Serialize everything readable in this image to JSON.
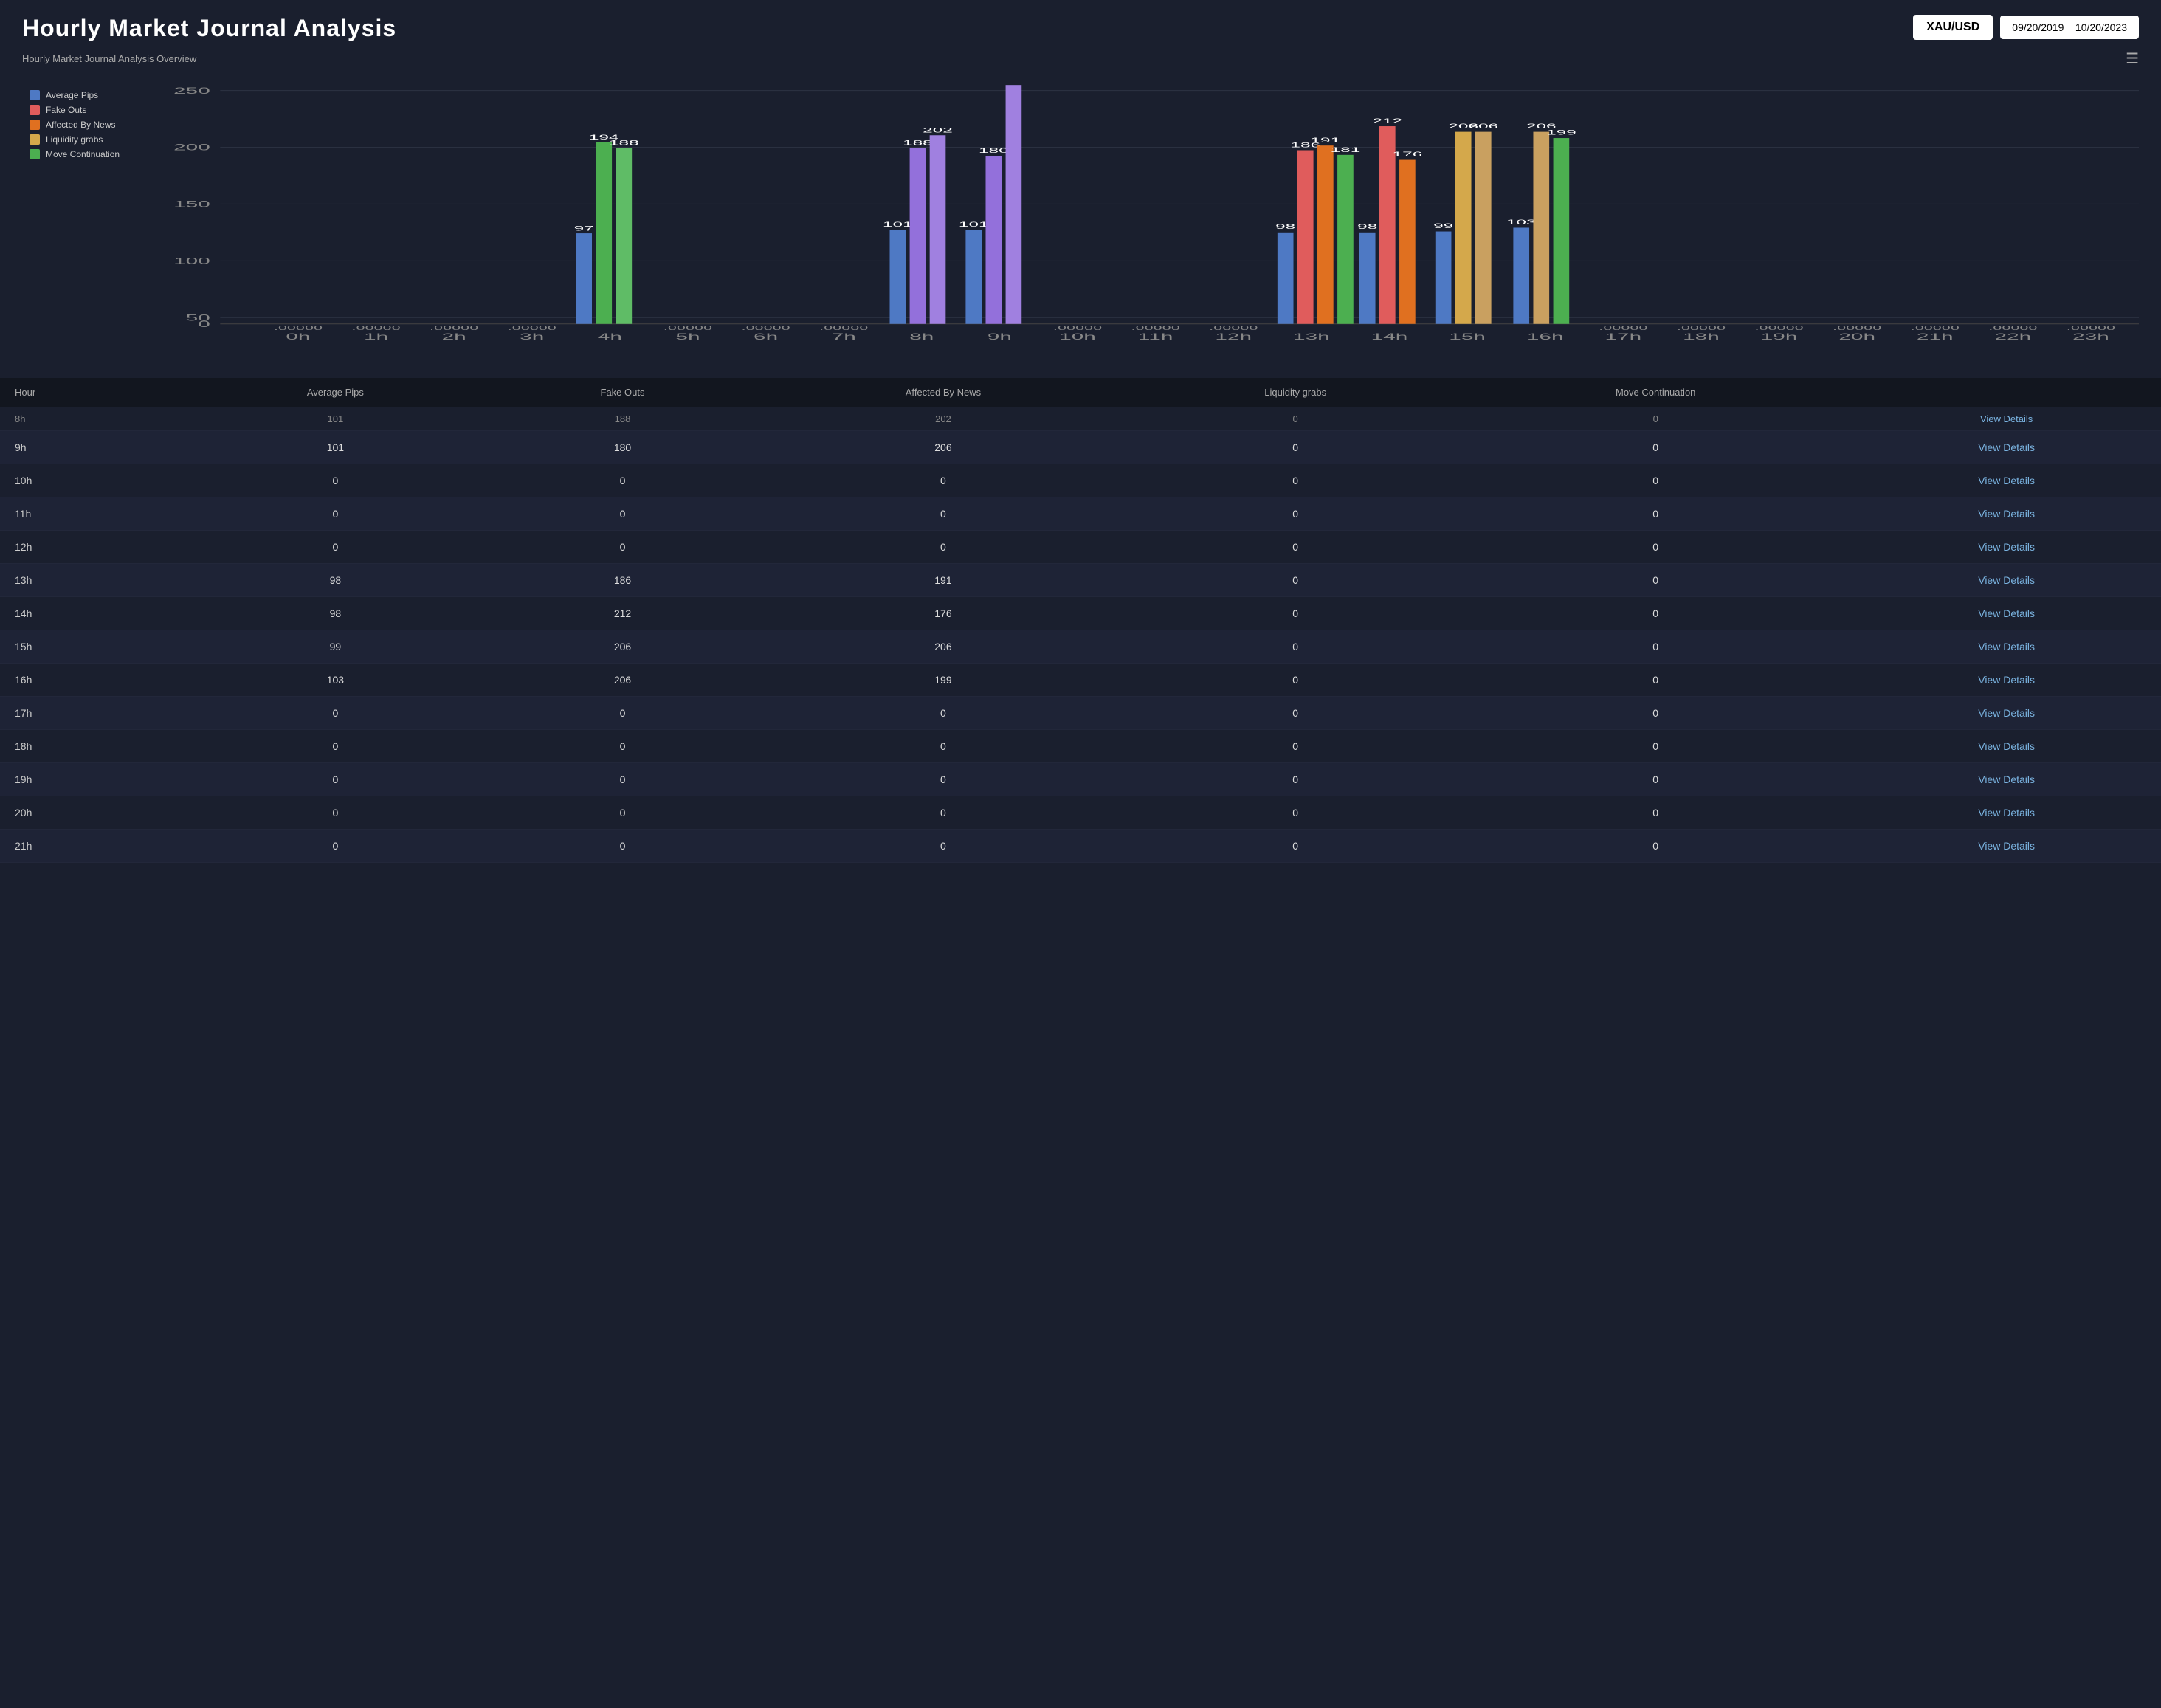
{
  "app": {
    "title": "Hourly Market Journal Analysis",
    "subtitle": "Hourly Market Journal Analysis Overview",
    "ticker": "XAU/USD",
    "date_start": "09/20/2019",
    "date_end": "10/20/2023"
  },
  "legend": [
    {
      "label": "Average Pips",
      "color": "#4e79c4"
    },
    {
      "label": "Fake Outs",
      "color": "#e05c5c"
    },
    {
      "label": "Affected By News",
      "color": "#e07020"
    },
    {
      "label": "Liquidity grabs",
      "color": "#d4a84b"
    },
    {
      "label": "Move Continuation",
      "color": "#4caf50"
    }
  ],
  "chart": {
    "y_max": 250,
    "y_labels": [
      0,
      50,
      100,
      150,
      200,
      250
    ],
    "x_labels": [
      "0h",
      "1h",
      "2h",
      "3h",
      "4h",
      "5h",
      "6h",
      "7h",
      "8h",
      "9h",
      "10h",
      "11h",
      "12h",
      "13h",
      "14h",
      "15h",
      "16h",
      "17h",
      "18h",
      "19h",
      "20h",
      "21h",
      "22h",
      "23h"
    ],
    "bars": {
      "4h": {
        "avg": 97,
        "fake": 0,
        "news": 0,
        "liq": 0,
        "cont": 194
      },
      "8h": {
        "avg": 101,
        "fake": 188,
        "news": 202,
        "liq": 0,
        "cont": 0
      },
      "9h": {
        "avg": 101,
        "fake": 180,
        "news": 256,
        "liq": 0,
        "cont": 0
      },
      "13h": {
        "avg": 98,
        "fake": 186,
        "news": 191,
        "liq": 0,
        "cont": 181
      },
      "14h": {
        "avg": 98,
        "fake": 212,
        "news": 176,
        "liq": 0,
        "cont": 0
      },
      "15h": {
        "avg": 99,
        "fake": 206,
        "news": 206,
        "liq": 0,
        "cont": 0
      },
      "16h": {
        "avg": 103,
        "fake": 0,
        "news": 199,
        "liq": 0,
        "cont": 206
      }
    }
  },
  "table": {
    "columns": [
      "Hour",
      "Average Pips",
      "Fake Outs",
      "Affected By News",
      "Liquidity grabs",
      "Move Continuation",
      ""
    ],
    "partial_row": {
      "hour": "8h",
      "avg": 101,
      "fake": 188,
      "news": 202,
      "liq": 0,
      "cont": 0
    },
    "rows": [
      {
        "hour": "9h",
        "avg": 101,
        "fake": 180,
        "news": 206,
        "liq": 0,
        "cont": 0,
        "action": "View Details"
      },
      {
        "hour": "10h",
        "avg": 0,
        "fake": 0,
        "news": 0,
        "liq": 0,
        "cont": 0,
        "action": "View Details"
      },
      {
        "hour": "11h",
        "avg": 0,
        "fake": 0,
        "news": 0,
        "liq": 0,
        "cont": 0,
        "action": "View Details"
      },
      {
        "hour": "12h",
        "avg": 0,
        "fake": 0,
        "news": 0,
        "liq": 0,
        "cont": 0,
        "action": "View Details"
      },
      {
        "hour": "13h",
        "avg": 98,
        "fake": 186,
        "news": 191,
        "liq": 0,
        "cont": 0,
        "action": "View Details"
      },
      {
        "hour": "14h",
        "avg": 98,
        "fake": 212,
        "news": 176,
        "liq": 0,
        "cont": 0,
        "action": "View Details"
      },
      {
        "hour": "15h",
        "avg": 99,
        "fake": 206,
        "news": 206,
        "liq": 0,
        "cont": 0,
        "action": "View Details"
      },
      {
        "hour": "16h",
        "avg": 103,
        "fake": 206,
        "news": 199,
        "liq": 0,
        "cont": 0,
        "action": "View Details"
      },
      {
        "hour": "17h",
        "avg": 0,
        "fake": 0,
        "news": 0,
        "liq": 0,
        "cont": 0,
        "action": "View Details"
      },
      {
        "hour": "18h",
        "avg": 0,
        "fake": 0,
        "news": 0,
        "liq": 0,
        "cont": 0,
        "action": "View Details"
      },
      {
        "hour": "19h",
        "avg": 0,
        "fake": 0,
        "news": 0,
        "liq": 0,
        "cont": 0,
        "action": "View Details"
      },
      {
        "hour": "20h",
        "avg": 0,
        "fake": 0,
        "news": 0,
        "liq": 0,
        "cont": 0,
        "action": "View Details"
      },
      {
        "hour": "21h",
        "avg": 0,
        "fake": 0,
        "news": 0,
        "liq": 0,
        "cont": 0,
        "action": "View Details"
      }
    ]
  }
}
